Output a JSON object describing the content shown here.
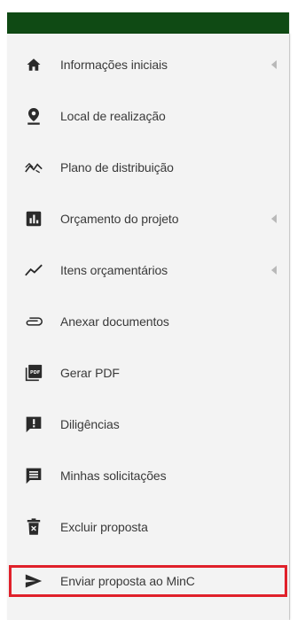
{
  "sidebar": {
    "items": [
      {
        "label": "Informações iniciais",
        "icon": "home-icon",
        "has_submenu": true
      },
      {
        "label": "Local de realização",
        "icon": "location-pin-icon",
        "has_submenu": false
      },
      {
        "label": "Plano de distribuição",
        "icon": "distribution-icon",
        "has_submenu": false
      },
      {
        "label": "Orçamento do projeto",
        "icon": "bar-chart-icon",
        "has_submenu": true
      },
      {
        "label": "Itens orçamentários",
        "icon": "trending-line-icon",
        "has_submenu": true
      },
      {
        "label": "Anexar documentos",
        "icon": "paperclip-icon",
        "has_submenu": false
      },
      {
        "label": "Gerar PDF",
        "icon": "pdf-icon",
        "has_submenu": false
      },
      {
        "label": "Diligências",
        "icon": "alert-box-icon",
        "has_submenu": false
      },
      {
        "label": "Minhas solicitações",
        "icon": "message-icon",
        "has_submenu": false
      },
      {
        "label": "Excluir proposta",
        "icon": "trash-icon",
        "has_submenu": false
      },
      {
        "label": "Enviar proposta ao MinC",
        "icon": "send-icon",
        "has_submenu": false
      }
    ]
  },
  "colors": {
    "topbar": "#0f4a14",
    "highlight_border": "#e0202a",
    "icon": "#2a2a2a",
    "text": "#3a3a3a"
  }
}
